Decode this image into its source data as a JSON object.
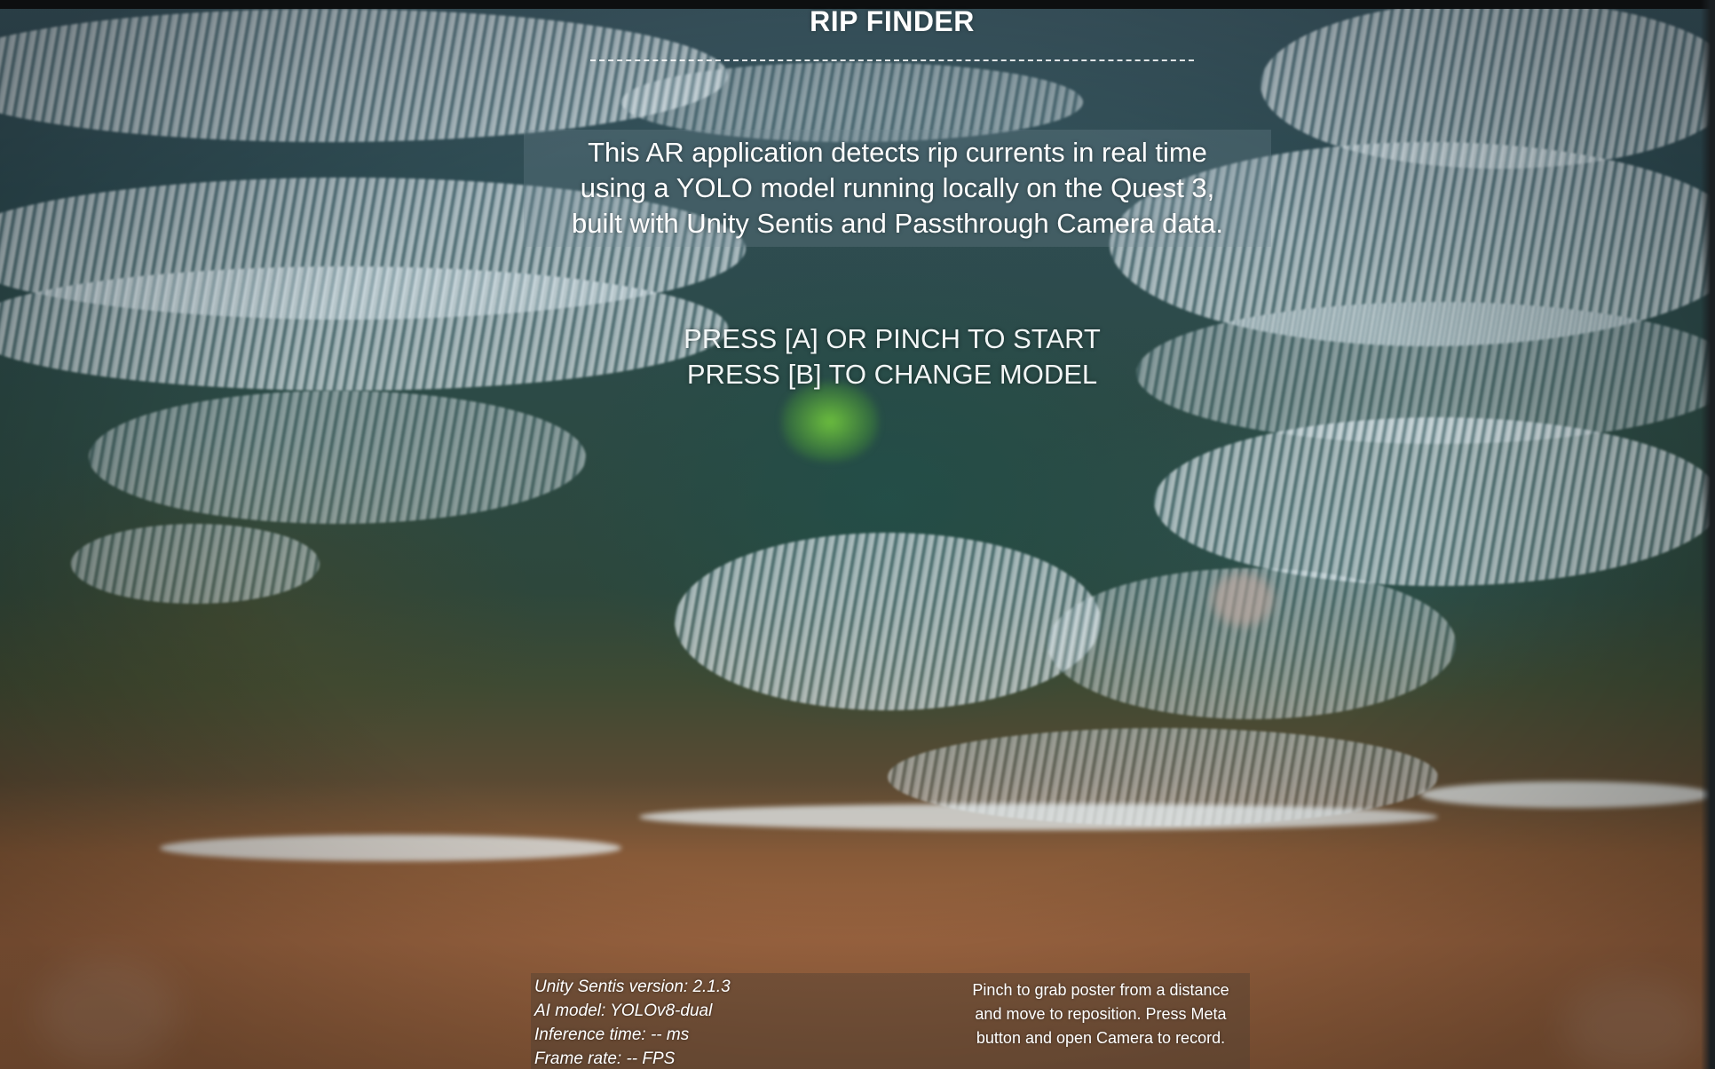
{
  "app": {
    "title": "RIP FINDER"
  },
  "description": {
    "lines": [
      "This AR application detects rip currents in real time",
      "using a YOLO model running locally on the Quest 3,",
      "built with Unity Sentis and Passthrough Camera data."
    ]
  },
  "prompts": {
    "start": "PRESS [A] OR PINCH TO START",
    "change_model": "PRESS [B] TO CHANGE MODEL"
  },
  "stats": {
    "sentis_version": "Unity Sentis version: 2.1.3",
    "ai_model": "AI model: YOLOv8-dual",
    "inference_time": "Inference time: -- ms",
    "frame_rate": "Frame rate: -- FPS"
  },
  "help": {
    "lines": [
      "Pinch to grab poster from a distance",
      "and move to reposition. Press Meta",
      "button and open Camera to record."
    ]
  },
  "colors": {
    "text": "#ffffff",
    "rip_highlight": "#78d23c",
    "sand": "#9b6440",
    "ocean": "#2e4c53"
  }
}
